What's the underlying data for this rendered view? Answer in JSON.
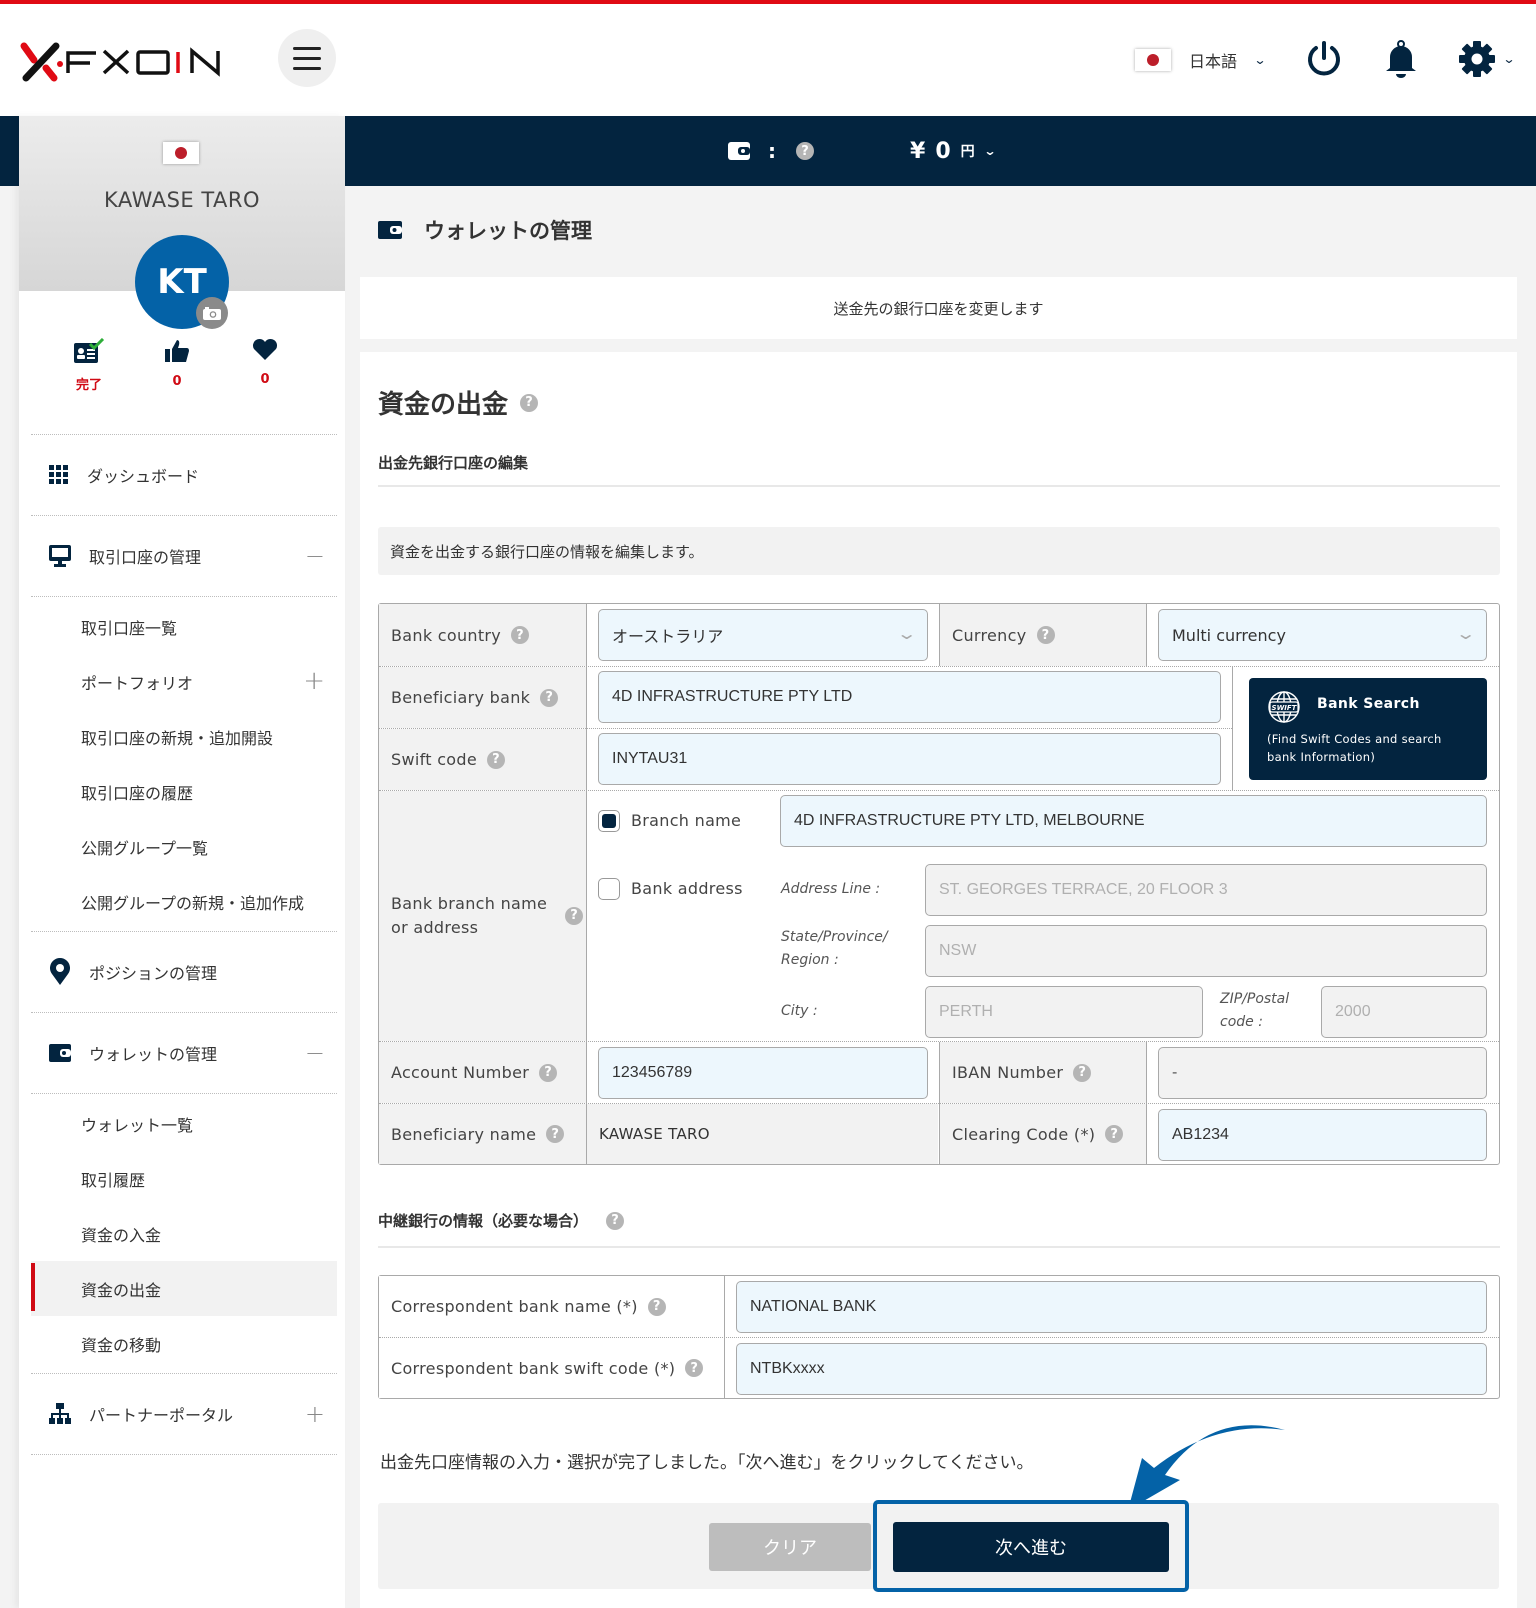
{
  "header": {
    "brand": "FXON",
    "language": "日本語",
    "icons": [
      "menu-icon",
      "power-icon",
      "bell-icon",
      "gear-icon"
    ]
  },
  "balance_bar": {
    "colon": ":",
    "help": "?",
    "currency_symbol": "¥",
    "amount": "0",
    "unit": "円"
  },
  "profile": {
    "name": "KAWASE TARO",
    "initials": "KT",
    "stats": [
      {
        "icon": "id-card-check-icon",
        "value": "完了"
      },
      {
        "icon": "thumbs-up-icon",
        "value": "0"
      },
      {
        "icon": "heart-icon",
        "value": "0"
      }
    ]
  },
  "sidebar": {
    "dashboard": "ダッシュボード",
    "trading_accounts": {
      "label": "取引口座の管理",
      "toggle": "−",
      "items": [
        {
          "label": "取引口座一覧"
        },
        {
          "label": "ポートフォリオ",
          "toggle": "+"
        },
        {
          "label": "取引口座の新規・追加開設"
        },
        {
          "label": "取引口座の履歴"
        },
        {
          "label": "公開グループ一覧"
        },
        {
          "label": "公開グループの新規・追加作成"
        }
      ]
    },
    "positions": "ポジションの管理",
    "wallet": {
      "label": "ウォレットの管理",
      "toggle": "−",
      "items": [
        {
          "label": "ウォレット一覧"
        },
        {
          "label": "取引履歴"
        },
        {
          "label": "資金の入金"
        },
        {
          "label": "資金の出金",
          "active": true
        },
        {
          "label": "資金の移動"
        }
      ]
    },
    "partner": {
      "label": "パートナーポータル",
      "toggle": "+"
    }
  },
  "main": {
    "page_title": "ウォレットの管理",
    "notice": "送金先の銀行口座を変更します",
    "card_title": "資金の出金",
    "section1_title": "出金先銀行口座の編集",
    "section1_info": "資金を出金する銀行口座の情報を編集します。",
    "form": {
      "bank_country": {
        "label": "Bank country",
        "value": "オーストラリア"
      },
      "currency": {
        "label": "Currency",
        "value": "Multi currency"
      },
      "beneficiary_bank": {
        "label": "Beneficiary bank",
        "value": "4D INFRASTRUCTURE PTY LTD"
      },
      "swift_code": {
        "label": "Swift code",
        "value": "INYTAU31"
      },
      "bank_search": {
        "title": "Bank Search",
        "subtitle_line1": "(Find Swift Codes and search",
        "subtitle_line2": "bank Information)",
        "icon_text": "SWIFT"
      },
      "branch": {
        "label_line1": "Bank branch name",
        "label_line2": "or address",
        "branch_name_option": "Branch name",
        "branch_name_checked": true,
        "branch_name_value": "4D INFRASTRUCTURE PTY LTD, MELBOURNE",
        "bank_address_option": "Bank address",
        "bank_address_checked": false,
        "address_line_label": "Address Line :",
        "address_line_value": "ST. GEORGES TERRACE, 20 FLOOR 3",
        "state_label_line1": "State/Province/",
        "state_label_line2": "Region :",
        "state_value": "NSW",
        "city_label": "City :",
        "city_value": "PERTH",
        "zip_label_line1": "ZIP/Postal",
        "zip_label_line2": "code :",
        "zip_value": "2000"
      },
      "account_number": {
        "label": "Account Number",
        "value": "123456789"
      },
      "iban_number": {
        "label": "IBAN Number",
        "value": "-"
      },
      "beneficiary_name": {
        "label": "Beneficiary name",
        "value": "KAWASE TARO"
      },
      "clearing_code": {
        "label": "Clearing Code (*)",
        "value": "AB1234"
      }
    },
    "section2_title": "中継銀行の情報（必要な場合）",
    "correspondent": {
      "bank_name": {
        "label": "Correspondent bank name (*)",
        "value": "NATIONAL BANK"
      },
      "swift_code": {
        "label": "Correspondent bank swift code (*)",
        "value": "NTBKxxxx"
      }
    },
    "final_message": "出金先口座情報の入力・選択が完了しました。「次へ進む」をクリックしてください。",
    "buttons": {
      "clear": "クリア",
      "next": "次へ進む"
    }
  },
  "colors": {
    "brand_red": "#e00a14",
    "navy": "#03243f",
    "accent_blue": "#0462a7",
    "input_bg": "#edf7fd"
  }
}
